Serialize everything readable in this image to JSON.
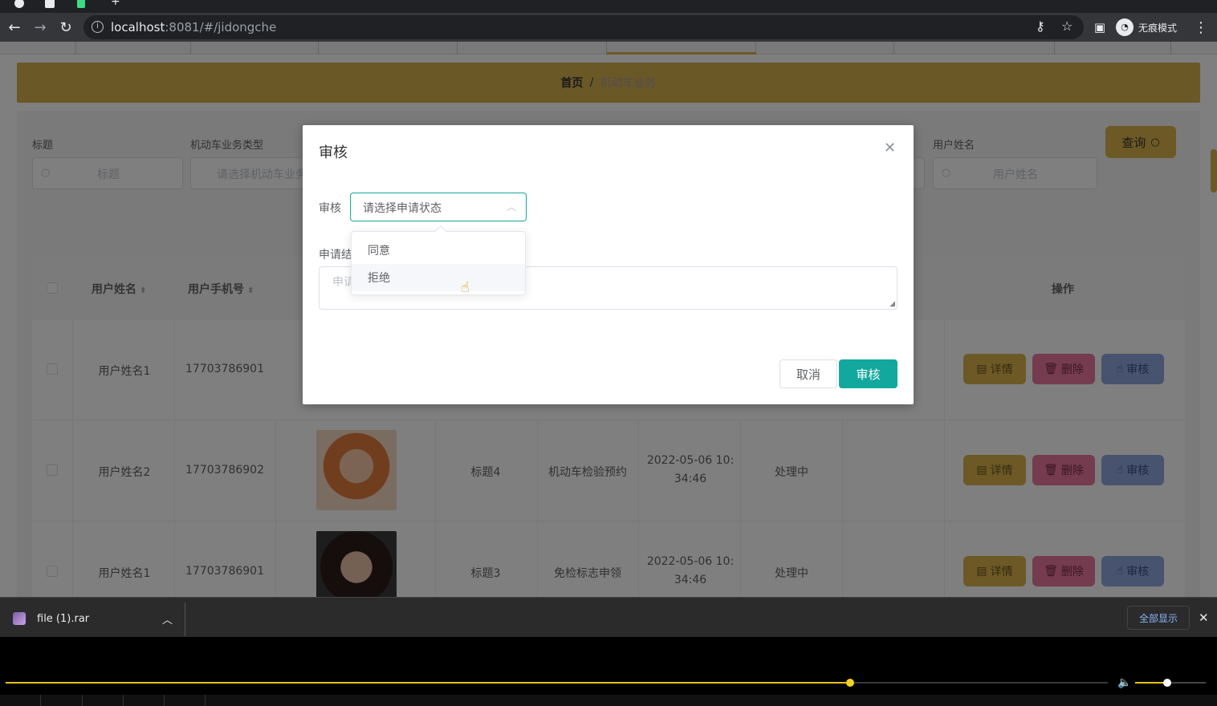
{
  "browser": {
    "url_host": "localhost",
    "url_rest": ":8081/#/jidongche",
    "incognito_label": "无痕模式"
  },
  "breadcrumb": {
    "home": "首页",
    "separator": "/",
    "current": "机动车业务"
  },
  "filters": {
    "title_label": "标题",
    "title_placeholder": "标题",
    "type_label": "机动车业务类型",
    "type_placeholder": "请选择机动车业务类型",
    "username_label": "用户姓名",
    "username_placeholder": "用户姓名",
    "query_button": "查询"
  },
  "table": {
    "headers": {
      "username": "用户姓名",
      "phone": "用户手机号",
      "actions": "操作"
    },
    "rows": [
      {
        "username": "用户姓名1",
        "phone": "17703786901",
        "title": "",
        "type": "",
        "time_line1": "",
        "time_line2": "",
        "status": ""
      },
      {
        "username": "用户姓名2",
        "phone": "17703786902",
        "title": "标题4",
        "type": "机动车检验预约",
        "time_line1": "2022-05-06 10:",
        "time_line2": "34:46",
        "status": "处理中"
      },
      {
        "username": "用户姓名1",
        "phone": "17703786901",
        "title": "标题3",
        "type": "免检标志申领",
        "time_line1": "2022-05-06 10:",
        "time_line2": "34:46",
        "status": "处理中"
      }
    ],
    "action_labels": {
      "detail": "详情",
      "delete": "删除",
      "audit": "审核"
    }
  },
  "dialog": {
    "title": "审核",
    "status_label": "审核",
    "status_placeholder": "请选择申请状态",
    "result_label": "申请结",
    "result_placeholder": "申请",
    "cancel_button": "取消",
    "confirm_button": "审核",
    "options": [
      "同意",
      "拒绝"
    ],
    "hovered_option": "拒绝"
  },
  "download_bar": {
    "file_name": "file (1).rar",
    "show_all": "全部显示"
  },
  "player": {
    "progress": 0.766,
    "volume": 0.45
  },
  "colors": {
    "accent": "#d9b24a",
    "primary": "#13a89e",
    "danger": "#e8799c",
    "info": "#8fa7de"
  }
}
